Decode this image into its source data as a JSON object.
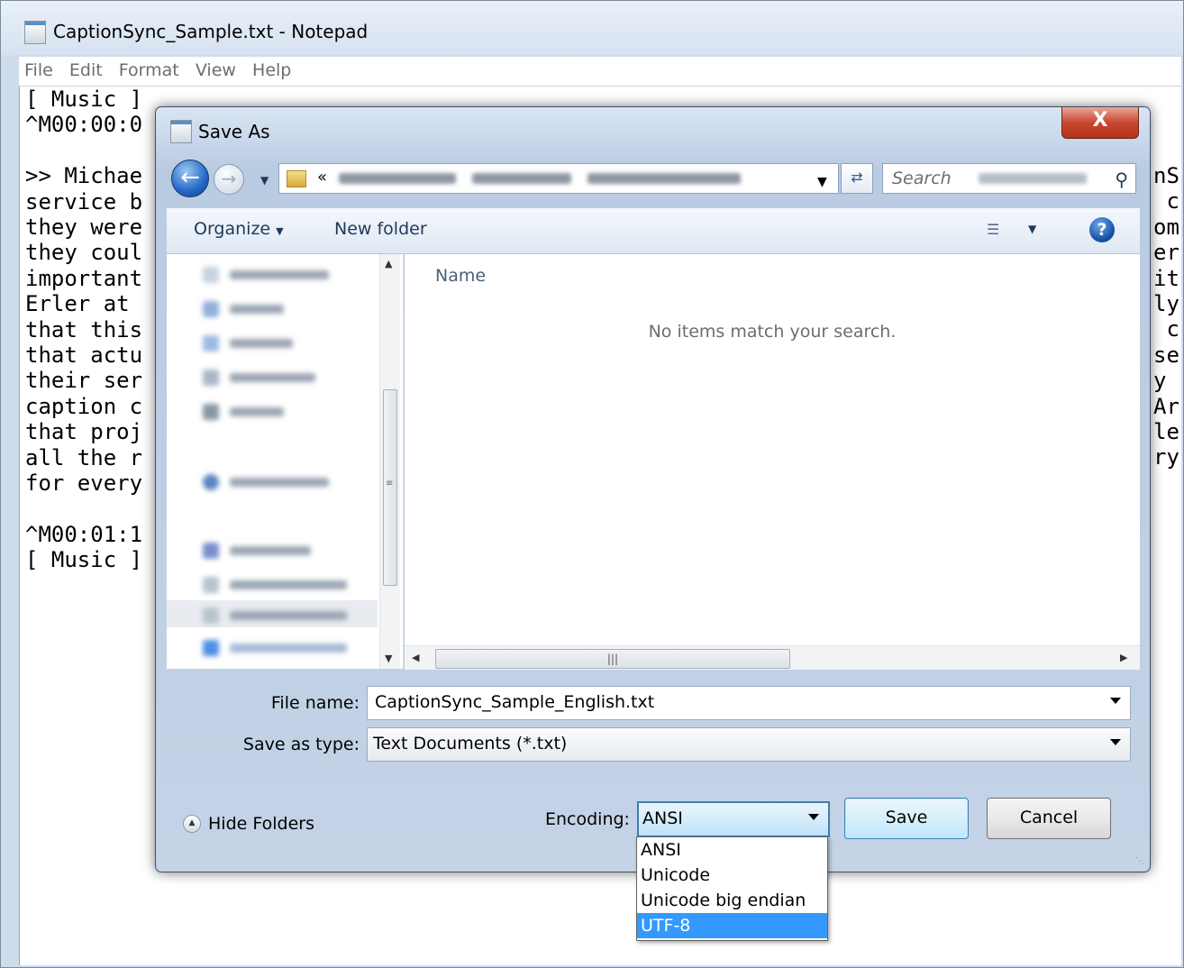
{
  "notepad": {
    "title": "CaptionSync_Sample.txt - Notepad",
    "menu": [
      "File",
      "Edit",
      "Format",
      "View",
      "Help"
    ],
    "text": "[ Music ]\n^M00:00:0\n\n>> Michae\nservice b\nthey were\nthey coul\nimportant\nErler at \nthat this\nthat actu\ntheir ser\ncaption c\nthat proj\nall the r\nfor every\n\n^M00:01:1\n[ Music ]",
    "right_edge_text": "nS\n c\nom\ner\nit\nly\n c\nse\ny \nAr\nle\nry"
  },
  "dialog": {
    "title": "Save As",
    "close_label": "X",
    "address": {
      "chevron": "«"
    },
    "search_placeholder": "Search",
    "toolbar": {
      "organize_label": "Organize",
      "new_folder_label": "New folder"
    },
    "file_list": {
      "column_name": "Name",
      "empty_message": "No items match your search."
    },
    "file_name_label": "File name:",
    "file_name_value": "CaptionSync_Sample_English.txt",
    "save_as_type_label": "Save as type:",
    "save_as_type_value": "Text Documents (*.txt)",
    "hide_folders_label": "Hide Folders",
    "encoding_label": "Encoding:",
    "encoding_value": "ANSI",
    "encoding_options": [
      "ANSI",
      "Unicode",
      "Unicode big endian",
      "UTF-8"
    ],
    "encoding_highlighted": "UTF-8",
    "save_label": "Save",
    "cancel_label": "Cancel"
  },
  "colors": {
    "accent": "#3399ff",
    "close_button": "#c8472f",
    "title_bar": "#d6e2f0"
  },
  "icons": [
    "notepad-icon",
    "back-arrow-icon",
    "forward-arrow-icon",
    "folder-icon",
    "refresh-icon",
    "search-icon",
    "view-options-icon",
    "help-icon",
    "hide-folders-icon"
  ]
}
